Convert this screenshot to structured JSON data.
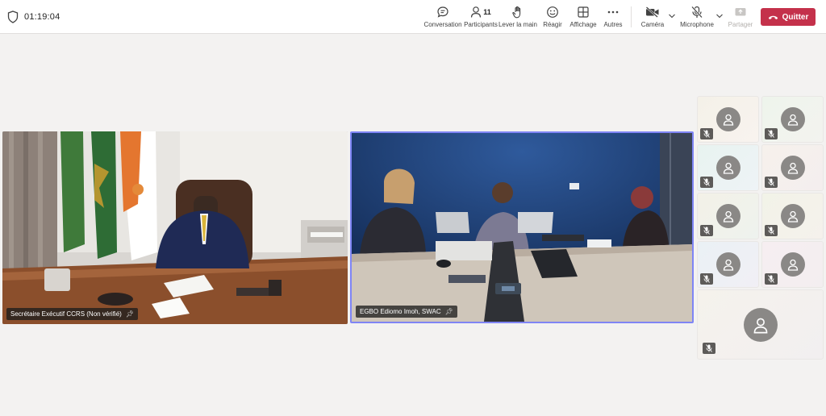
{
  "meeting": {
    "elapsed": "01:19:04"
  },
  "toolbar": {
    "conversation": "Conversation",
    "participants": "Participants",
    "participant_count": "11",
    "raise_hand": "Lever la main",
    "react": "Réagir",
    "view": "Affichage",
    "more": "Autres",
    "camera": "Caméra",
    "microphone": "Microphone",
    "share": "Partager",
    "leave": "Quitter"
  },
  "videos": [
    {
      "name": "Secrétaire Exécutif CCRS (Non vérifié)"
    },
    {
      "name": "EGBO Ediomo Imoh, SWAC"
    }
  ],
  "colors": {
    "leave": "#c4314b",
    "active_speaker": "#7f85f5"
  }
}
